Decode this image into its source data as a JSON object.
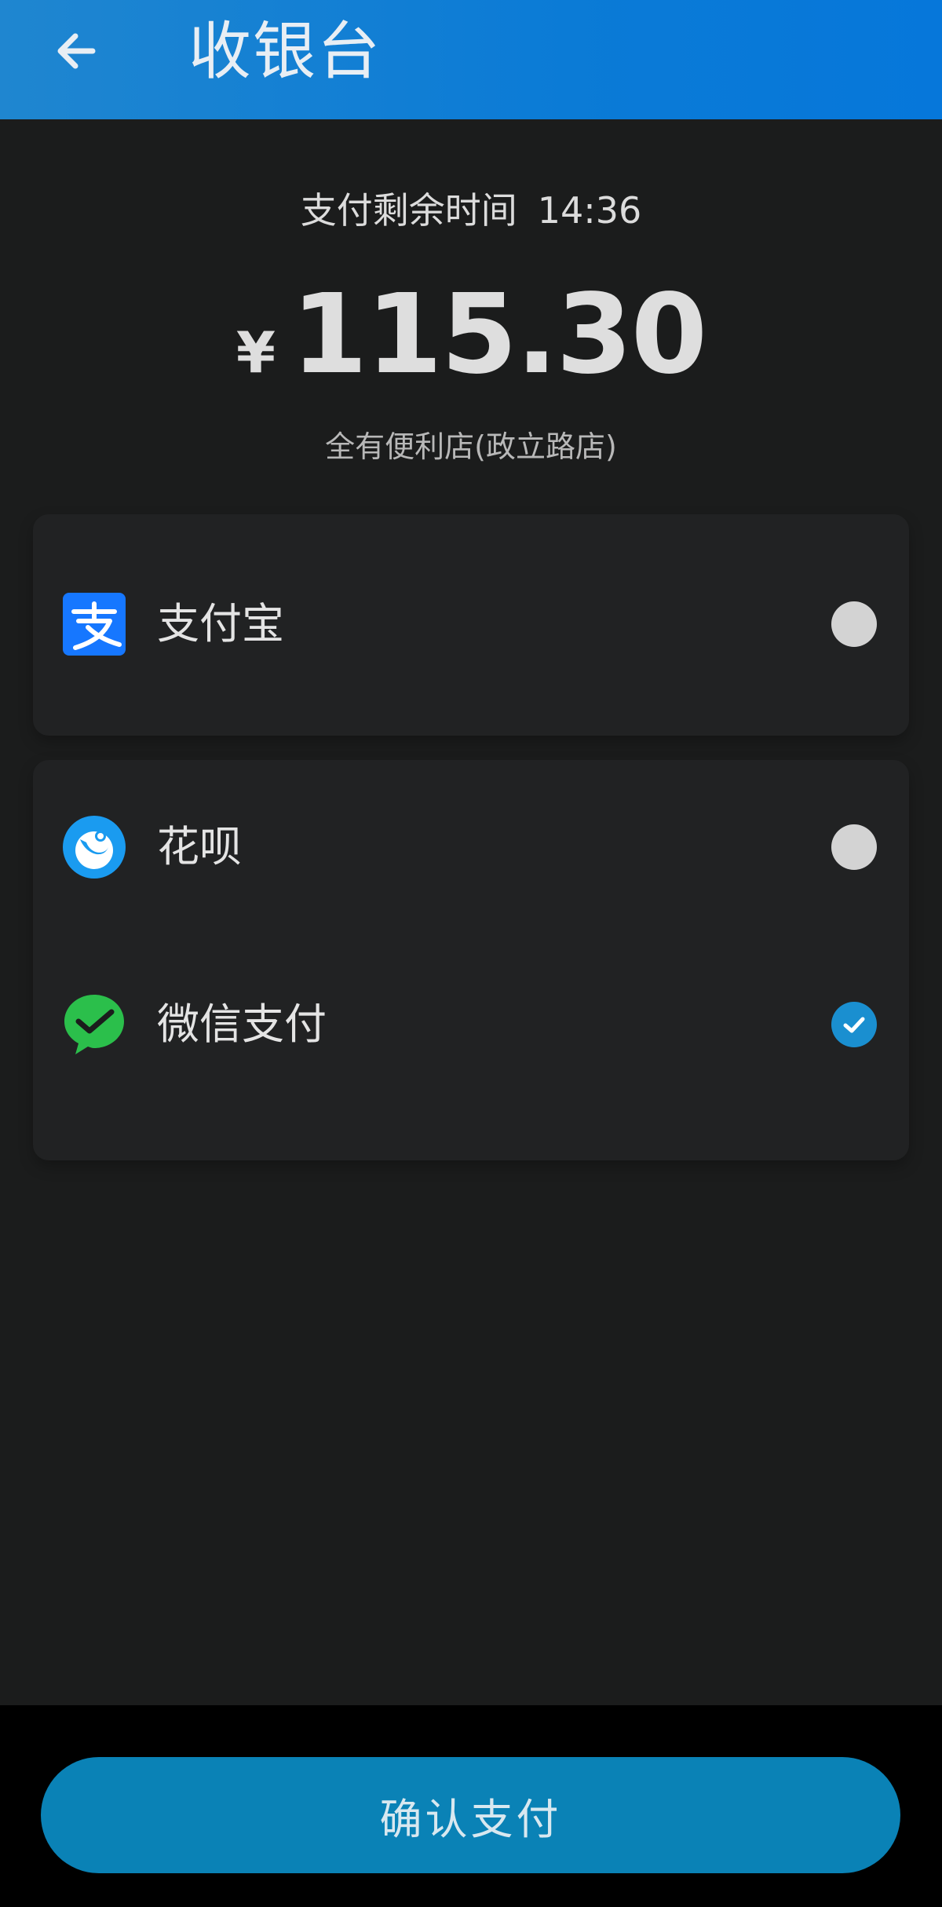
{
  "header": {
    "title": "收银台",
    "back_icon": "arrow-left-icon"
  },
  "countdown": {
    "label": "支付剩余时间",
    "time": "14:36"
  },
  "amount": {
    "currency": "¥",
    "value": "115.30"
  },
  "merchant": "全有便利店(政立路店)",
  "payment_methods": [
    {
      "label": "支付宝",
      "icon": "alipay-icon",
      "selected": false
    },
    {
      "label": "花呗",
      "icon": "huabei-icon",
      "selected": false
    },
    {
      "label": "微信支付",
      "icon": "wechat-pay-icon",
      "selected": true
    }
  ],
  "confirm_button": "确认支付",
  "colors": {
    "header": "#0b7bd6",
    "accent": "#1a8fd0",
    "button": "#0a82b6",
    "background": "#1b1c1c"
  }
}
